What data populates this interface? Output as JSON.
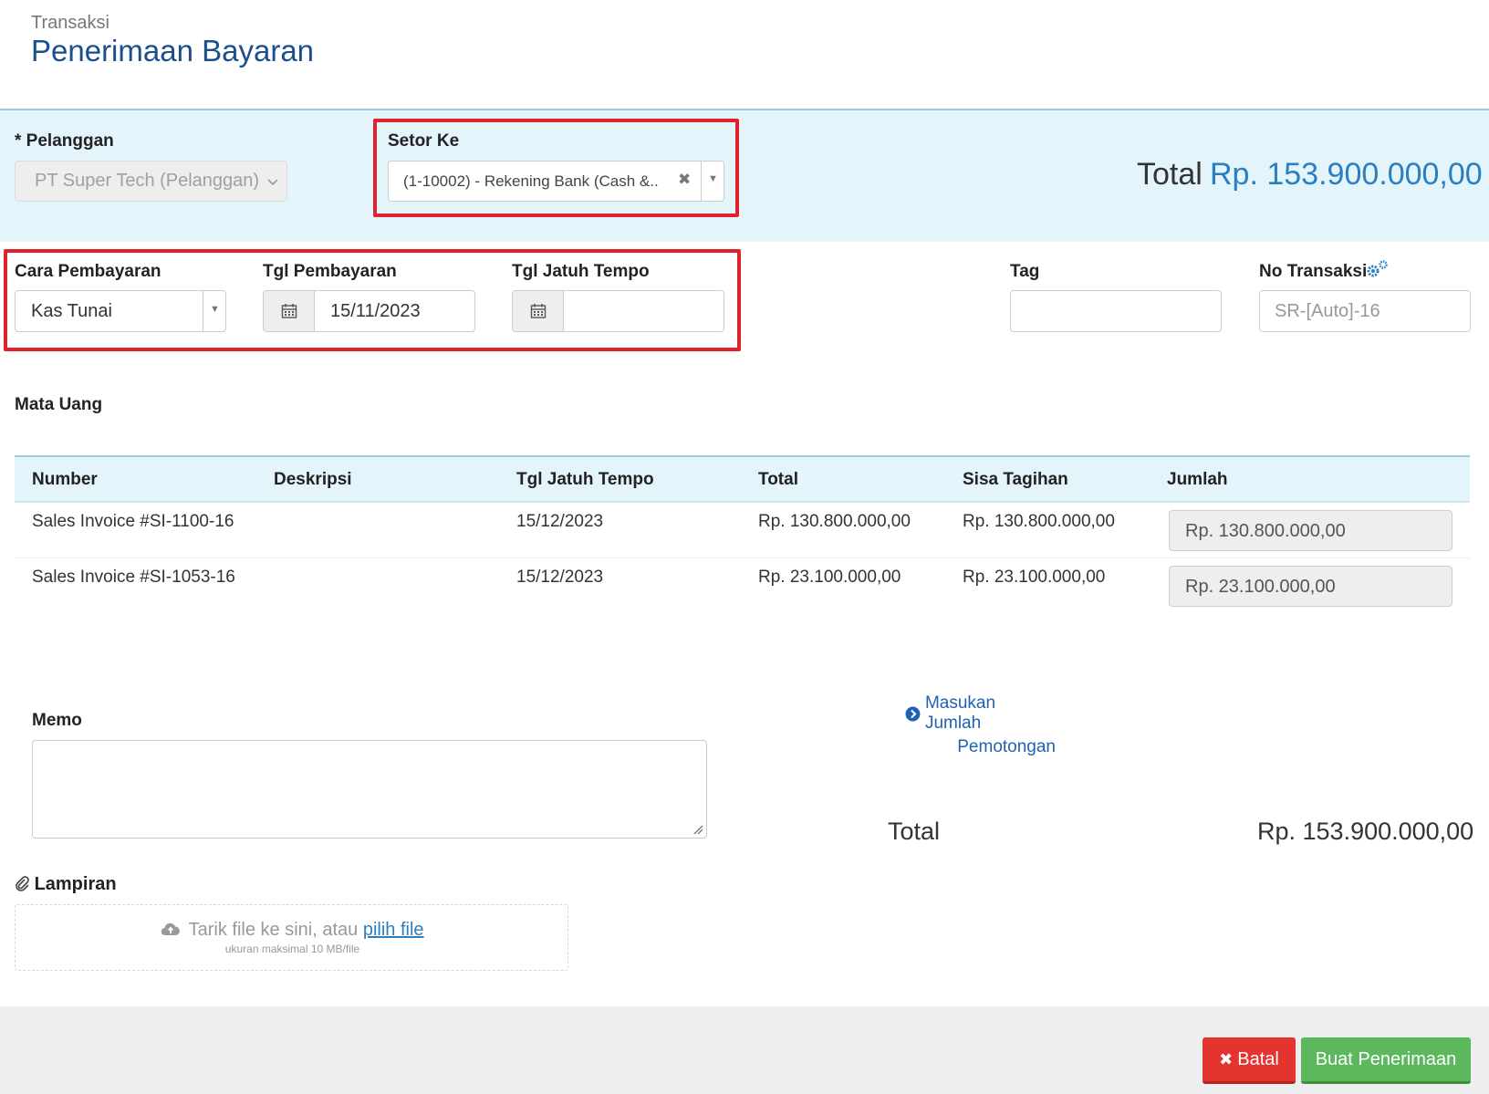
{
  "header": {
    "breadcrumb": "Transaksi",
    "title": "Penerimaan Bayaran"
  },
  "form": {
    "pelanggan_label": "* Pelanggan",
    "pelanggan_value": "PT Super Tech (Pelanggan)",
    "setor_ke_label": "Setor Ke",
    "setor_ke_value": "(1-10002) - Rekening Bank (Cash &...",
    "total_label": "Total",
    "total_value": "Rp. 153.900.000,00",
    "cara_pembayaran_label": "Cara Pembayaran",
    "cara_pembayaran_value": "Kas Tunai",
    "tgl_pembayaran_label": "Tgl Pembayaran",
    "tgl_pembayaran_value": "15/11/2023",
    "tgl_jatuh_tempo_label": "Tgl Jatuh Tempo",
    "tgl_jatuh_tempo_value": "",
    "tag_label": "Tag",
    "tag_value": "",
    "no_transaksi_label": "No Transaksi",
    "no_transaksi_placeholder": "SR-[Auto]-16",
    "mata_uang_label": "Mata Uang"
  },
  "table": {
    "headers": [
      "Number",
      "Deskripsi",
      "Tgl Jatuh Tempo",
      "Total",
      "Sisa Tagihan",
      "Jumlah"
    ],
    "rows": [
      {
        "number": "Sales Invoice #SI-1100-16",
        "deskripsi": "",
        "due": "15/12/2023",
        "total": "Rp. 130.800.000,00",
        "sisa": "Rp. 130.800.000,00",
        "jumlah": "Rp. 130.800.000,00"
      },
      {
        "number": "Sales Invoice #SI-1053-16",
        "deskripsi": "",
        "due": "15/12/2023",
        "total": "Rp. 23.100.000,00",
        "sisa": "Rp. 23.100.000,00",
        "jumlah": "Rp. 23.100.000,00"
      }
    ]
  },
  "memo": {
    "label": "Memo",
    "value": ""
  },
  "potongan": {
    "line1": "Masukan Jumlah",
    "line2": "Pemotongan"
  },
  "summary": {
    "total_label": "Total",
    "total_value": "Rp. 153.900.000,00"
  },
  "attachment": {
    "label": "Lampiran",
    "drop_text": "Tarik file ke sini, atau",
    "drop_link": "pilih file",
    "size_note": "ukuran maksimal 10 MB/file"
  },
  "buttons": {
    "cancel": "Batal",
    "create": "Buat Penerimaan"
  },
  "colors": {
    "accent_blue": "#2a7fc1",
    "band": "#e3f4fb",
    "highlight_red": "#e0222b",
    "cancel": "#e3342f",
    "create": "#5cb85c"
  }
}
